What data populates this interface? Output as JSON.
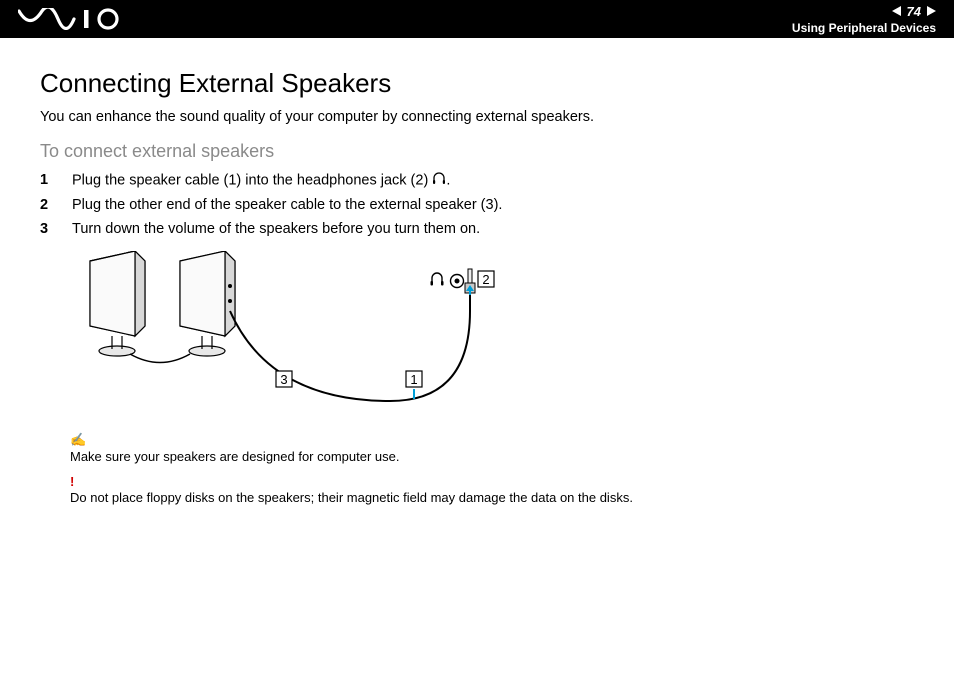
{
  "header": {
    "page_number": "74",
    "section": "Using Peripheral Devices"
  },
  "title": "Connecting External Speakers",
  "intro": "You can enhance the sound quality of your computer by connecting external speakers.",
  "subheading": "To connect external speakers",
  "steps": [
    {
      "num": "1",
      "text_before": "Plug the speaker cable (1) into the headphones jack (2) ",
      "text_after": ".",
      "has_icon": true
    },
    {
      "num": "2",
      "text_before": "Plug the other end of the speaker cable to the external speaker (3).",
      "text_after": "",
      "has_icon": false
    },
    {
      "num": "3",
      "text_before": "Turn down the volume of the speakers before you turn them on.",
      "text_after": "",
      "has_icon": false
    }
  ],
  "diagram_labels": {
    "l1": "1",
    "l2": "2",
    "l3": "3"
  },
  "note": "Make sure your speakers are designed for computer use.",
  "warning": "Do not place floppy disks on the speakers; their magnetic field may damage the data on the disks."
}
